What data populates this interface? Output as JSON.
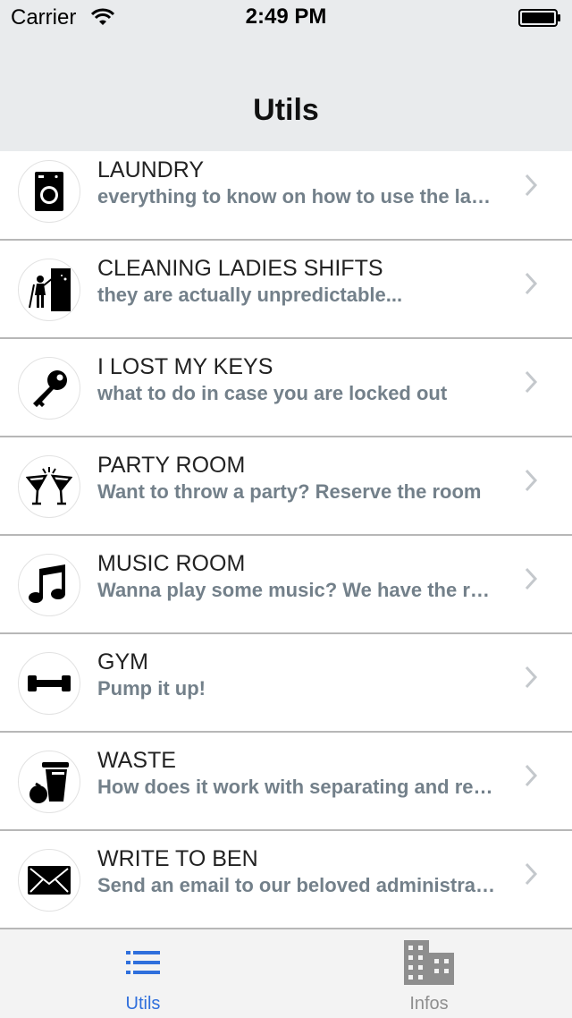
{
  "status_bar": {
    "carrier": "Carrier",
    "time": "2:49 PM"
  },
  "nav": {
    "title": "Utils"
  },
  "rows": [
    {
      "title": "LAUNDRY",
      "subtitle": "everything to know on how to use the laundry",
      "icon": "washing-machine-icon"
    },
    {
      "title": "CLEANING LADIES SHIFTS",
      "subtitle": "they are actually unpredictable...",
      "icon": "cleaning-lady-icon"
    },
    {
      "title": "I LOST MY KEYS",
      "subtitle": "what to do in case you are locked out",
      "icon": "key-icon"
    },
    {
      "title": "PARTY ROOM",
      "subtitle": "Want to throw a party? Reserve the room",
      "icon": "cocktail-glasses-icon"
    },
    {
      "title": "MUSIC ROOM",
      "subtitle": "Wanna play some music? We have the room",
      "icon": "music-note-icon"
    },
    {
      "title": "GYM",
      "subtitle": "Pump it up!",
      "icon": "dumbbell-icon"
    },
    {
      "title": "WASTE",
      "subtitle": "How does it work with separating and recycling",
      "icon": "trash-bin-icon"
    },
    {
      "title": "WRITE TO BEN",
      "subtitle": "Send an email to our beloved administrator",
      "icon": "envelope-icon"
    }
  ],
  "tabs": [
    {
      "label": "Utils",
      "icon": "list-icon",
      "active": true
    },
    {
      "label": "Infos",
      "icon": "building-icon",
      "active": false
    }
  ],
  "colors": {
    "accent": "#2f6fdc",
    "inactive": "#8e8e8e",
    "subtitle": "#73808a",
    "bar_bg": "#e9ebed"
  }
}
